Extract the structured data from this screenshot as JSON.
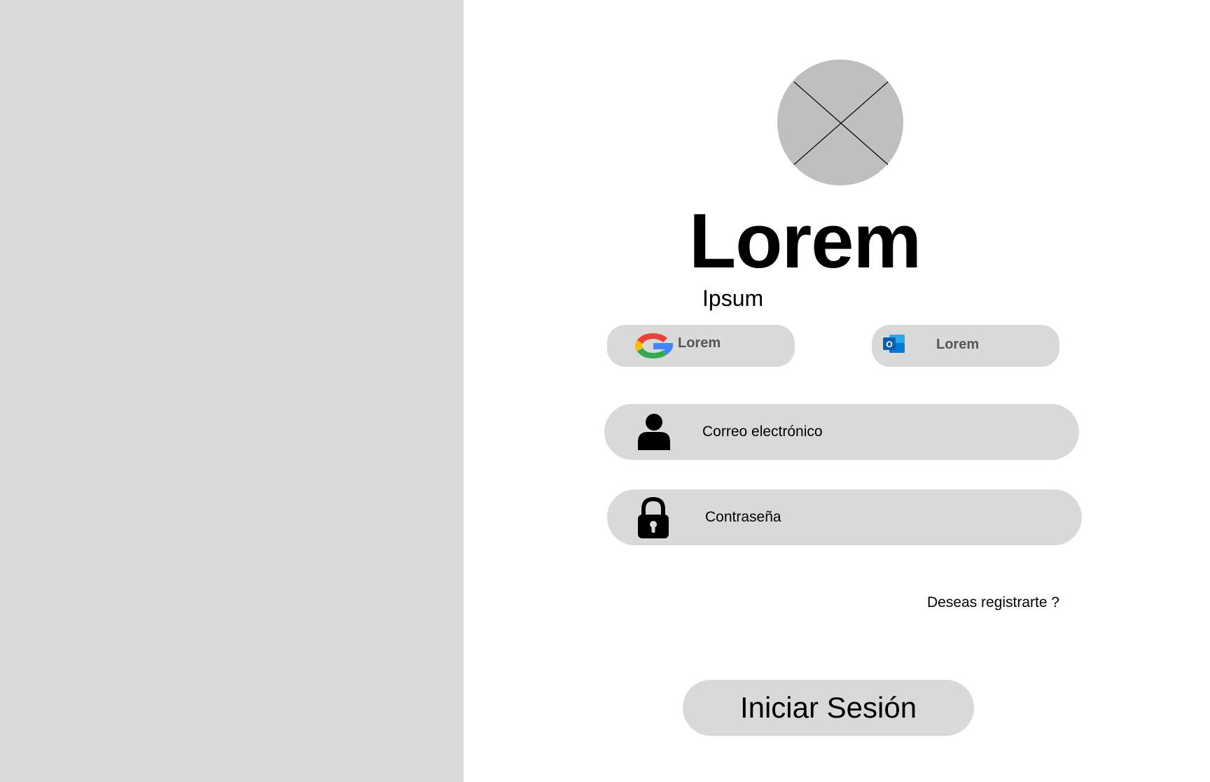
{
  "brand": {
    "title": "Lorem",
    "subtitle": "Ipsum",
    "logo_icon": "image-placeholder-icon"
  },
  "social": {
    "google": {
      "label": "Lorem",
      "icon": "google-icon"
    },
    "outlook": {
      "label": "Lorem",
      "icon": "outlook-icon"
    }
  },
  "form": {
    "email": {
      "placeholder": "Correo electrónico",
      "value": "",
      "icon": "user-icon"
    },
    "password": {
      "placeholder": "Contraseña",
      "value": "",
      "icon": "lock-icon"
    }
  },
  "links": {
    "register": "Deseas registrarte ?"
  },
  "actions": {
    "login_label": "Iniciar Sesión"
  },
  "colors": {
    "panel": "#d9d9d9",
    "background": "#ffffff",
    "placeholder_fill": "#bfbfbf",
    "text": "#000000",
    "button_text_muted": "#555555"
  }
}
